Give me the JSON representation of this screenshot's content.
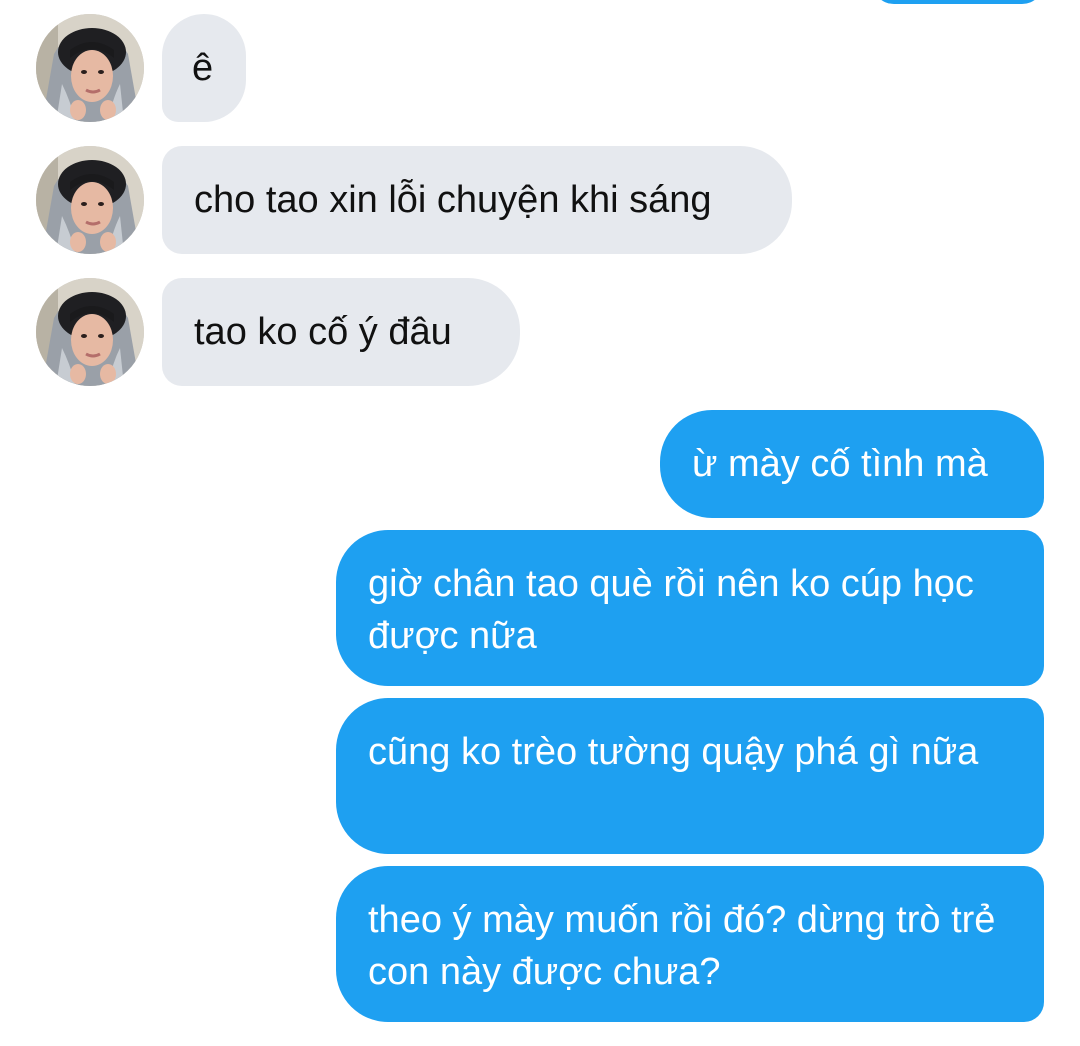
{
  "conversation": {
    "incoming": [
      {
        "text": "ê"
      },
      {
        "text": "cho tao xin lỗi chuyện khi sáng"
      },
      {
        "text": "tao ko cố ý đâu"
      }
    ],
    "outgoing": [
      {
        "text": "ừ mày cố tình mà"
      },
      {
        "text": "giờ chân tao què rồi nên ko cúp học được nữa"
      },
      {
        "text": "cũng ko trèo tường quậy phá gì nữa"
      },
      {
        "text": "theo ý mày muốn rồi đó? dừng trò trẻ con này được chưa?"
      }
    ]
  },
  "colors": {
    "outgoing_bubble": "#1ea0f1",
    "incoming_bubble": "#e6e9ee",
    "background": "#ffffff"
  },
  "icons": {
    "avatar": "sender-avatar-photo"
  }
}
